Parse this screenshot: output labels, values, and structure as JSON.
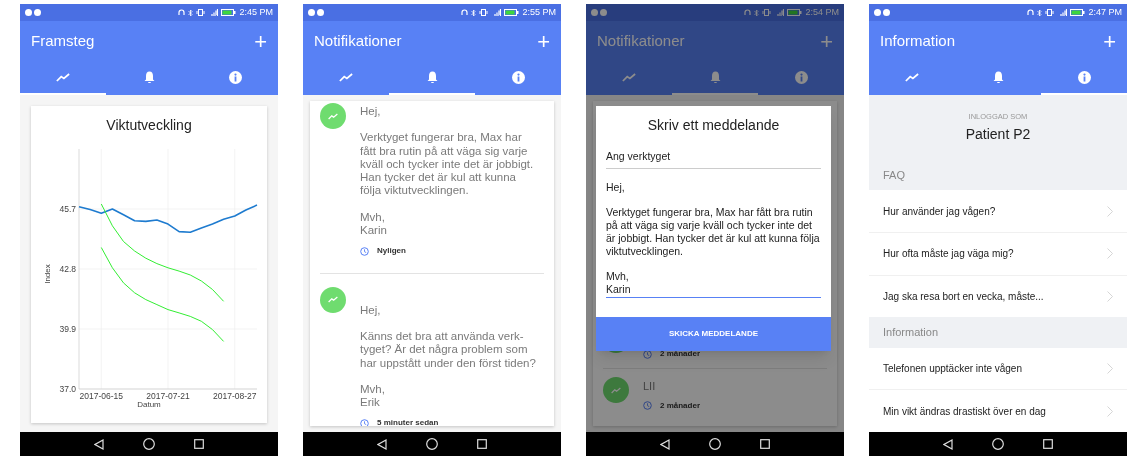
{
  "screens": [
    {
      "kind": "progress",
      "status_bar": {
        "time": "2:45 PM"
      },
      "app_bar": {
        "title": "Framsteg",
        "action": "+"
      },
      "tabs": [
        {
          "kind": "chart",
          "selected": true
        },
        {
          "kind": "bell",
          "selected": false
        },
        {
          "kind": "info",
          "selected": false
        }
      ],
      "card": {
        "title": "Viktutveckling",
        "chart_data": {
          "type": "line",
          "xlabel": "Datum",
          "ylabel": "Index",
          "categories": [
            null,
            null,
            "2017-06-15",
            null,
            null,
            null,
            null,
            null,
            "2017-07-21",
            null,
            null,
            null,
            null,
            null,
            "2017-08-27",
            null,
            null
          ],
          "ylim": [
            37.0,
            48.6
          ],
          "grid": true,
          "yticks": [
            {
              "value": 37.0,
              "label": "37.0"
            },
            {
              "value": 39.9,
              "label": "39.9"
            },
            {
              "value": 42.8,
              "label": "42.8"
            },
            {
              "value": 45.7,
              "label": "45.7"
            }
          ],
          "series": [
            {
              "color": "#1e7bcf",
              "values": [
                45.81,
                45.67,
                45.49,
                45.7,
                45.42,
                45.13,
                45.1,
                45.17,
                44.97,
                44.61,
                44.58,
                44.78,
                44.97,
                45.2,
                45.36,
                45.65,
                45.89
              ]
            },
            {
              "color": "#33ee33",
              "values": [
                null,
                null,
                45.94,
                44.89,
                44.13,
                43.67,
                43.32,
                43.06,
                42.86,
                42.7,
                42.51,
                42.22,
                41.81,
                41.24,
                null,
                null,
                null
              ]
            },
            {
              "color": "#33ee33",
              "values": [
                null,
                null,
                43.84,
                42.86,
                42.13,
                41.65,
                41.32,
                41.08,
                40.84,
                40.68,
                40.51,
                40.27,
                39.87,
                39.3,
                null,
                null,
                null
              ]
            }
          ]
        }
      }
    },
    {
      "kind": "notifications",
      "status_bar": {
        "time": "2:55 PM"
      },
      "app_bar": {
        "title": "Notifikationer",
        "action": "+"
      },
      "tabs": [
        {
          "kind": "chart",
          "selected": false
        },
        {
          "kind": "bell",
          "selected": true
        },
        {
          "kind": "info",
          "selected": false
        }
      ],
      "notifications": [
        {
          "greeting": "Hej,",
          "body": "Verktyget fungerar bra, Max har fått bra rutin på att väga sig varje kväll och tycker inte det är jobbigt. Han tycker det är kul att kunna följa viktutvecklingen.",
          "signoff": "Mvh,",
          "sender": "Karin",
          "time": "Nyligen"
        },
        {
          "greeting": "Hej,",
          "body": "Känns det bra att använda verk-tyget? Är det några problem som har uppstått under den först tiden?",
          "signoff": "Mvh,",
          "sender": "Erik",
          "time": "5 minuter sedan"
        }
      ]
    },
    {
      "kind": "compose",
      "status_bar": {
        "time": "2:54 PM"
      },
      "app_bar": {
        "title": "Notifikationer",
        "action": "+"
      },
      "tabs": [
        {
          "kind": "chart",
          "selected": false
        },
        {
          "kind": "bell",
          "selected": true
        },
        {
          "kind": "info",
          "selected": false
        }
      ],
      "background_items": [
        {
          "time": "2 månader"
        },
        {
          "title": "LII",
          "time": "2 månader"
        }
      ],
      "dialog": {
        "title": "Skriv ett meddelande",
        "subject": "Ang verktyget",
        "message": "Hej,\n\nVerktyget fungerar bra, Max har fått bra rutin på att väga sig varje kväll och tycker inte det är jobbigt. Han tycker det är kul att kunna följa viktutvecklingen.\n\nMvh,\nKarin",
        "button": "SKICKA MEDDELANDE"
      }
    },
    {
      "kind": "information",
      "status_bar": {
        "time": "2:47 PM"
      },
      "app_bar": {
        "title": "Information",
        "action": "+"
      },
      "tabs": [
        {
          "kind": "chart",
          "selected": false
        },
        {
          "kind": "bell",
          "selected": false
        },
        {
          "kind": "info",
          "selected": true
        }
      ],
      "account": {
        "label": "INLOGGAD SOM",
        "name": "Patient P2"
      },
      "sections": [
        {
          "title": "FAQ",
          "items": [
            "Hur använder jag vågen?",
            "Hur ofta måste jag väga mig?",
            "Jag ska resa bort en vecka, måste..."
          ]
        },
        {
          "title": "Information",
          "items": [
            "Telefonen upptäcker inte vågen",
            "Min vikt ändras drastiskt över en dag"
          ]
        }
      ]
    }
  ]
}
